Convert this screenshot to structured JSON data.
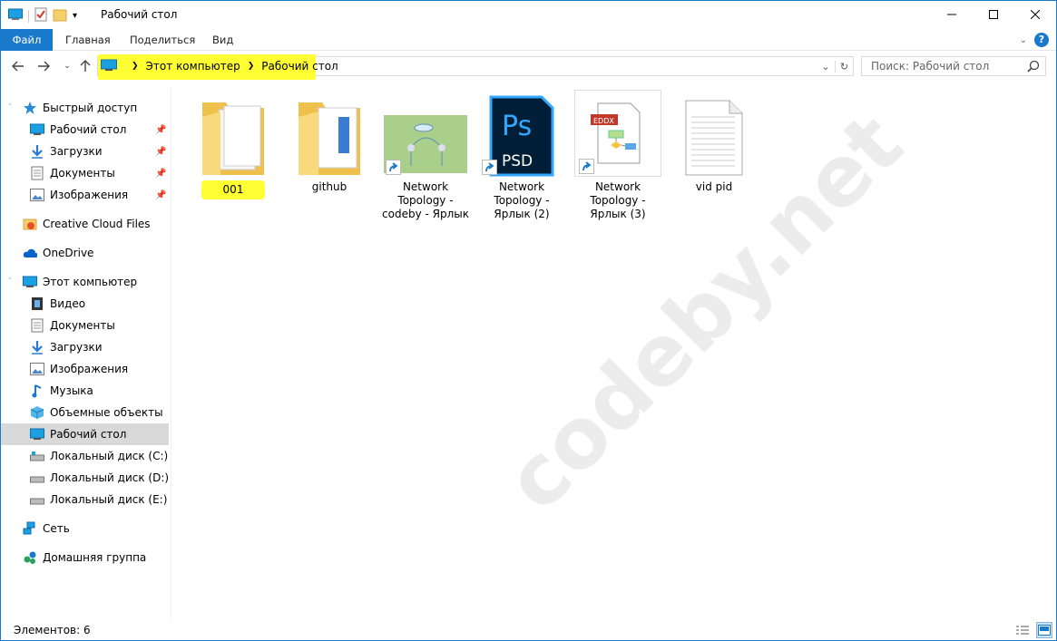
{
  "window": {
    "title": "Рабочий стол"
  },
  "ribbon": {
    "tabs": [
      "Файл",
      "Главная",
      "Поделиться",
      "Вид"
    ]
  },
  "address": {
    "crumbs": [
      "Этот компьютер",
      "Рабочий стол"
    ]
  },
  "search": {
    "placeholder": "Поиск: Рабочий стол"
  },
  "sidebar": {
    "quick_access": "Быстрый доступ",
    "quick_items": [
      "Рабочий стол",
      "Загрузки",
      "Документы",
      "Изображения"
    ],
    "creative_cloud": "Creative Cloud Files",
    "onedrive": "OneDrive",
    "this_pc": "Этот компьютер",
    "pc_items": [
      "Видео",
      "Документы",
      "Загрузки",
      "Изображения",
      "Музыка",
      "Объемные объекты",
      "Рабочий стол",
      "Локальный диск (C:)",
      "Локальный диск (D:)",
      "Локальный диск (E:)"
    ],
    "network": "Сеть",
    "homegroup": "Домашняя группа"
  },
  "content": {
    "items": [
      {
        "label": "001",
        "type": "folder"
      },
      {
        "label": "github",
        "type": "folder"
      },
      {
        "label": "Network Topology - codeby - Ярлык",
        "type": "shortcut-image"
      },
      {
        "label": "Network Topology - Ярлык (2)",
        "type": "shortcut-psd"
      },
      {
        "label": "Network Topology - Ярлык (3)",
        "type": "shortcut-eddx"
      },
      {
        "label": "vid pid",
        "type": "text-file"
      }
    ],
    "psd_label": "PSD",
    "ps_label": "Ps",
    "eddx_label": "EDDX"
  },
  "watermark": "codeby.net",
  "status": {
    "count": "Элементов: 6"
  },
  "colors": {
    "accent": "#1979ca",
    "highlight": "#ffff33",
    "folder": "#f5cf6a"
  }
}
